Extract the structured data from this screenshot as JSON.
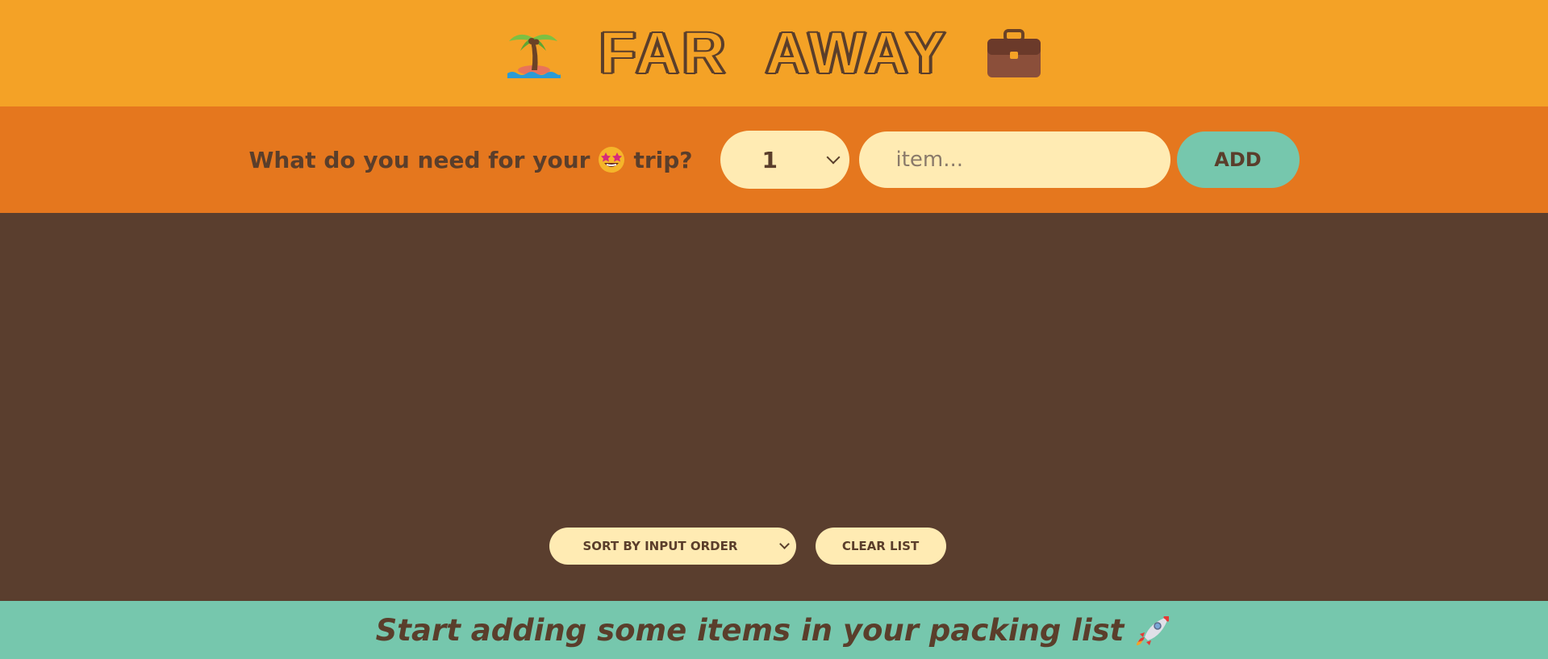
{
  "header": {
    "title": "FAR AWAY",
    "left_icon": "palm-island-icon",
    "right_icon": "briefcase-icon"
  },
  "form": {
    "question_before": "What do you need for your",
    "question_emoji": "star-struck-icon",
    "question_after": "trip?",
    "quantity_value": "1",
    "item_placeholder": "item...",
    "add_label": "ADD"
  },
  "list": {
    "sort_value": "SORT BY INPUT ORDER",
    "clear_label": "CLEAR LIST"
  },
  "stats": {
    "message": "Start adding some items in your packing list",
    "icon": "rocket-icon"
  },
  "colors": {
    "header_bg": "#f4a226",
    "form_bg": "#e5771e",
    "list_bg": "#5a3e2e",
    "stats_bg": "#76c7ad",
    "pill_bg": "#ffebb3",
    "text": "#5a3e2b"
  }
}
